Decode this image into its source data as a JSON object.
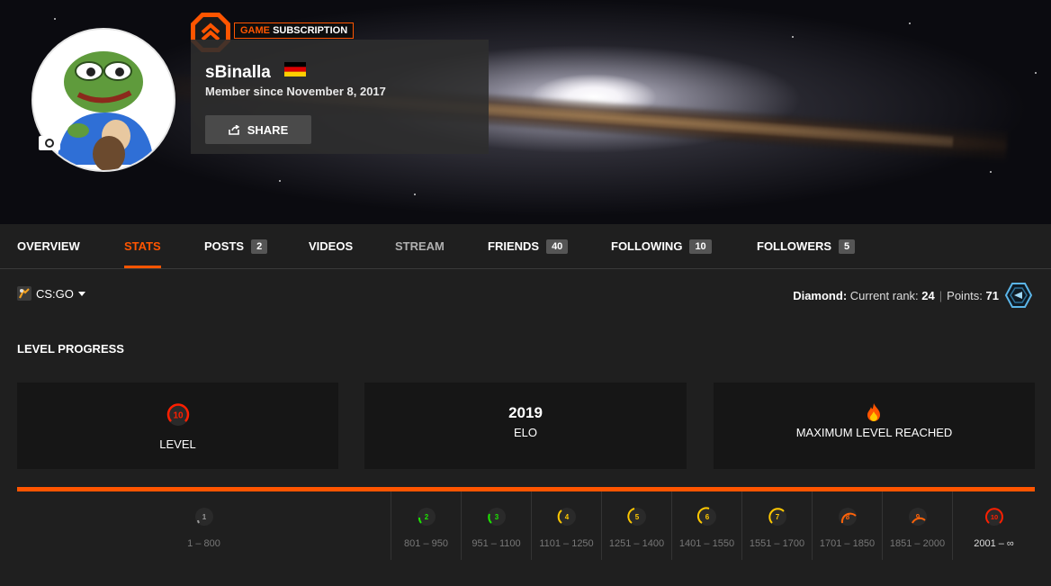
{
  "profile": {
    "subscription_prefix": "GAME",
    "subscription_suffix": "SUBSCRIPTION",
    "nickname": "sBinalla",
    "country_flag": "germany-flag",
    "member_since": "Member since November 8, 2017",
    "share_label": "SHARE"
  },
  "tabs": [
    {
      "label": "OVERVIEW",
      "count": null,
      "state": "normal"
    },
    {
      "label": "STATS",
      "count": null,
      "state": "active"
    },
    {
      "label": "POSTS",
      "count": "2",
      "state": "normal"
    },
    {
      "label": "VIDEOS",
      "count": null,
      "state": "normal"
    },
    {
      "label": "STREAM",
      "count": null,
      "state": "disabled"
    },
    {
      "label": "FRIENDS",
      "count": "40",
      "state": "normal"
    },
    {
      "label": "FOLLOWING",
      "count": "10",
      "state": "normal"
    },
    {
      "label": "FOLLOWERS",
      "count": "5",
      "state": "normal"
    }
  ],
  "game_selector": {
    "label": "CS:GO"
  },
  "ladder": {
    "tier": "Diamond",
    "rank_label": "Current rank:",
    "rank": "24",
    "points_label": "Points:",
    "points": "71"
  },
  "level_progress": {
    "title": "LEVEL PROGRESS",
    "level_value": "10",
    "level_label": "LEVEL",
    "elo_value": "2019",
    "elo_label": "ELO",
    "max_label": "MAXIMUM LEVEL REACHED"
  },
  "levels": [
    {
      "level": "1",
      "range": "1 – 800",
      "color": "#9a9a9a"
    },
    {
      "level": "2",
      "range": "801 – 950",
      "color": "#1ce400"
    },
    {
      "level": "3",
      "range": "951 – 1100",
      "color": "#1ce400"
    },
    {
      "level": "4",
      "range": "1101 – 1250",
      "color": "#ffc800"
    },
    {
      "level": "5",
      "range": "1251 – 1400",
      "color": "#ffc800"
    },
    {
      "level": "6",
      "range": "1401 – 1550",
      "color": "#ffc800"
    },
    {
      "level": "7",
      "range": "1551 – 1700",
      "color": "#ffc800"
    },
    {
      "level": "8",
      "range": "1701 – 1850",
      "color": "#ff6309"
    },
    {
      "level": "9",
      "range": "1851 – 2000",
      "color": "#ff6309"
    },
    {
      "level": "10",
      "range": "2001 – ∞",
      "color": "#fe1f00"
    }
  ],
  "colors": {
    "accent": "#ff5500",
    "level10": "#fe1f00",
    "diamond": "#5bb5e8"
  }
}
